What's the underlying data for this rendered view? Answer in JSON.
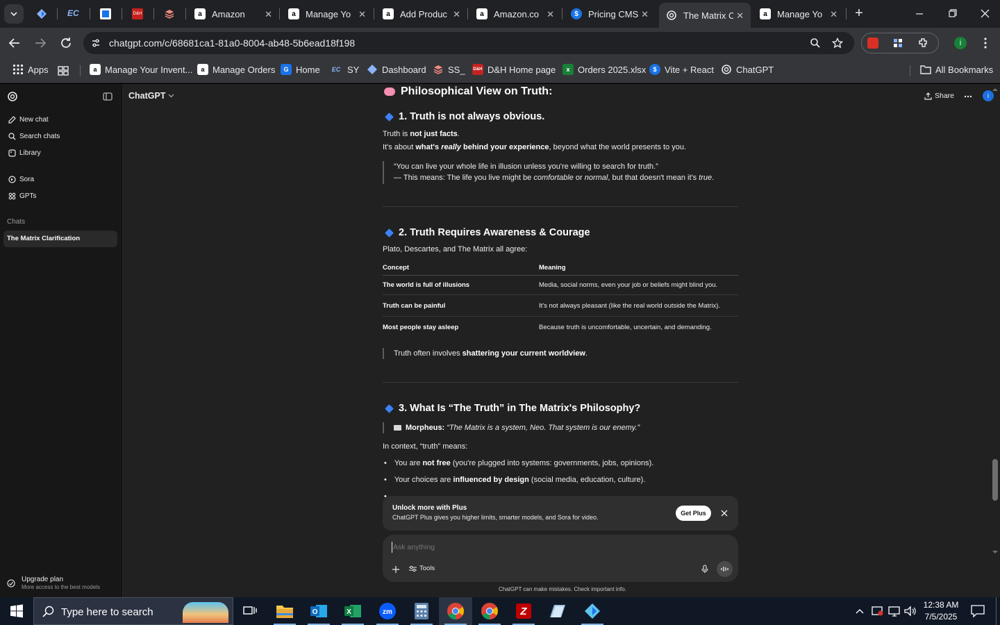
{
  "browser": {
    "tabs": [
      {
        "title": "Amazon",
        "icon": "amazon-icon"
      },
      {
        "title": "Manage Yo",
        "icon": "amazon-icon"
      },
      {
        "title": "Add Produc",
        "icon": "amazon-icon"
      },
      {
        "title": "Amazon.co",
        "icon": "amazon-icon"
      },
      {
        "title": "Pricing CMS",
        "icon": "dollar-icon"
      },
      {
        "title": "The Matrix C",
        "icon": "chatgpt-icon",
        "active": true
      },
      {
        "title": "Manage Yo",
        "icon": "amazon-icon"
      }
    ],
    "url": "chatgpt.com/c/68681ca1-81a0-8004-ab48-5b6ead18f198",
    "bookmarks": [
      "Apps",
      "Manage Your Invent...",
      "Manage Orders",
      "Home",
      "SY",
      "Dashboard",
      "SS_",
      "D&H Home page",
      "Orders 2025.xlsx",
      "Vite + React",
      "ChatGPT"
    ],
    "all_bookmarks": "All Bookmarks",
    "profile_initial": "i"
  },
  "sidebar": {
    "new_chat": "New chat",
    "search_chats": "Search chats",
    "library": "Library",
    "sora": "Sora",
    "gpts": "GPTs",
    "chats_heading": "Chats",
    "active_chat": "The Matrix Clarification",
    "upgrade_title": "Upgrade plan",
    "upgrade_sub": "More access to the best models"
  },
  "header": {
    "model": "ChatGPT",
    "share": "Share",
    "avatar_initial": "i"
  },
  "content": {
    "section0_title": "Philosophical View on Truth:",
    "s1": {
      "title": "1. Truth is not always obvious.",
      "line1_a": "Truth is ",
      "line1_b": "not just facts",
      "line1_c": ".",
      "line2_a": "It's about ",
      "line2_b": "what's ",
      "line2_c": "really",
      "line2_d": " behind your experience",
      "line2_e": ", beyond what the world presents to you.",
      "quote1": "“You can live your whole life in illusion unless you're willing to search for truth.”",
      "quote2_a": "— This means: The life you live might be ",
      "quote2_b": "comfortable",
      "quote2_c": " or ",
      "quote2_d": "normal",
      "quote2_e": ", but that doesn't mean it's ",
      "quote2_f": "true",
      "quote2_g": "."
    },
    "s2": {
      "title": "2. Truth Requires Awareness & Courage",
      "intro": "Plato, Descartes, and The Matrix all agree:",
      "table_headers": [
        "Concept",
        "Meaning"
      ],
      "rows": [
        [
          "The world is full of illusions",
          "Media, social norms, even your job or beliefs might blind you."
        ],
        [
          "Truth can be painful",
          "It's not always pleasant (like the real world outside the Matrix)."
        ],
        [
          "Most people stay asleep",
          "Because truth is uncomfortable, uncertain, and demanding."
        ]
      ],
      "callout_a": "Truth often involves ",
      "callout_b": "shattering your current worldview",
      "callout_c": "."
    },
    "s3": {
      "title": "3. What Is “The Truth” in The Matrix's Philosophy?",
      "quote_a": "Morpheus: ",
      "quote_b": "“The Matrix is a system, Neo. That system is our enemy.”",
      "intro": "In context, “truth” means:",
      "b1_a": "You are ",
      "b1_b": "not free",
      "b1_c": " (you're plugged into systems: governments, jobs, opinions).",
      "b2_a": "Your choices are ",
      "b2_b": "influenced by design",
      "b2_c": " (social media, education, culture)."
    }
  },
  "promo": {
    "title": "Unlock more with Plus",
    "sub": "ChatGPT Plus gives you higher limits, smarter models, and Sora for video.",
    "button": "Get Plus"
  },
  "composer": {
    "placeholder": "Ask anything",
    "tools": "Tools",
    "disclaimer": "ChatGPT can make mistakes. Check important info."
  },
  "taskbar": {
    "search_placeholder": "Type here to search",
    "time": "12:38 AM",
    "date": "7/5/2025"
  },
  "colors": {
    "accent_blue": "#3b82f6",
    "chrome_dark": "#202124",
    "chrome_toolbar": "#35363a",
    "chat_bg": "#212121",
    "sidebar_bg": "#171717"
  }
}
